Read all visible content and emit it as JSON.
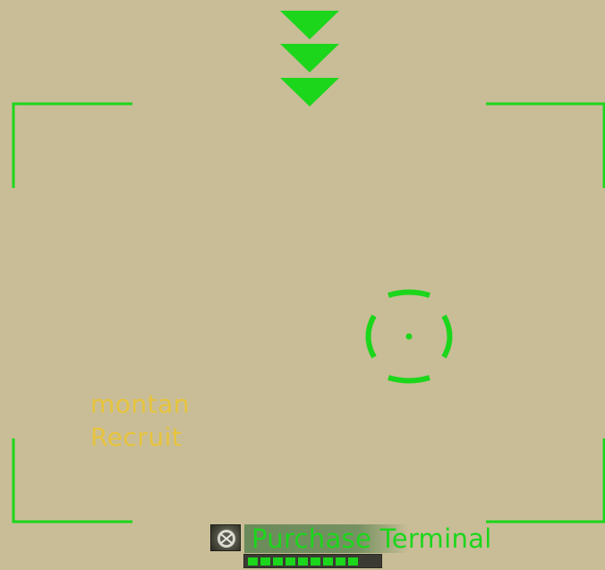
{
  "hud": {
    "accent_color": "#1cd61c",
    "background_color": "#c8bd96",
    "player_name_color": "#e8c43c",
    "indicator_icon": "triple-chevron-down-icon",
    "reticle_icon": "crosshair-icon"
  },
  "player_tag": {
    "name": "montan",
    "rank": "Recruit"
  },
  "target": {
    "icon": "terminal-portrait-icon",
    "name": "Purchase Terminal",
    "health_fraction": 1.0,
    "health_segments": 9
  }
}
